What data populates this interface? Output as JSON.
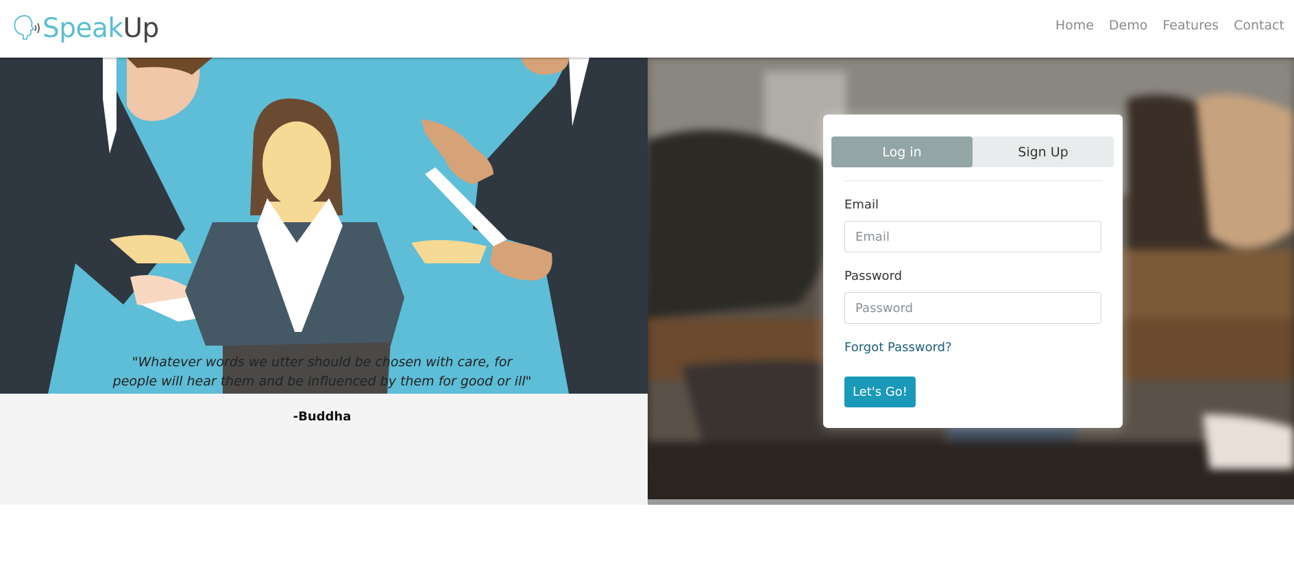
{
  "brand": {
    "speak": "Speak",
    "up": "Up",
    "icon": "speaking-head-icon"
  },
  "nav": [
    "Home",
    "Demo",
    "Features",
    "Contact"
  ],
  "quote": {
    "text": "\"Whatever words we utter should be chosen with care, for people will hear them and be influenced by them for good or ill\"",
    "author": "-Buddha"
  },
  "login": {
    "tabs": {
      "login": "Log in",
      "signup": "Sign Up"
    },
    "email": {
      "label": "Email",
      "placeholder": "Email"
    },
    "password": {
      "label": "Password",
      "placeholder": "Password"
    },
    "forgot": "Forgot Password?",
    "submit": "Let's Go!"
  },
  "colors": {
    "brand_accent": "#5bbdd3",
    "illustration_bg": "#5ebdd7",
    "active_tab": "#94a5a5",
    "primary_button": "#1a99b8",
    "link": "#1a5f7a"
  }
}
